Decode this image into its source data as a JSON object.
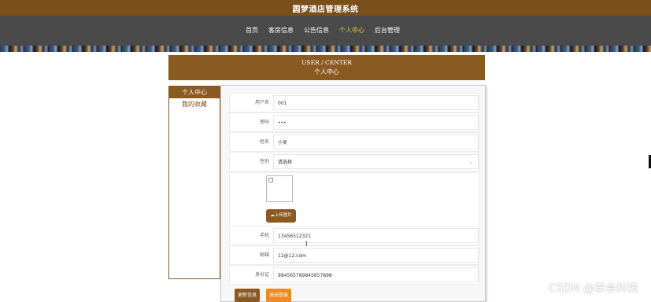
{
  "header": {
    "site_title": "圆梦酒店管理系统"
  },
  "nav": {
    "items": [
      {
        "label": "首页"
      },
      {
        "label": "客房信息"
      },
      {
        "label": "公告信息"
      },
      {
        "label": "个人中心",
        "active": true
      },
      {
        "label": "后台管理"
      }
    ]
  },
  "center": {
    "title_en": "USER / CENTER",
    "title_cn": "个人中心"
  },
  "sidebar": {
    "items": [
      {
        "label": "个人中心",
        "active": true
      },
      {
        "label": "我的收藏"
      }
    ]
  },
  "form": {
    "fields": [
      {
        "label": "用户名",
        "value": "001"
      },
      {
        "label": "密码",
        "value": "•••"
      },
      {
        "label": "姓名",
        "value": "小吴"
      },
      {
        "label": "性别",
        "value": "请选择"
      },
      {
        "label": "手机",
        "value": "13456512321"
      },
      {
        "label": "邮箱",
        "value": "12@12.com"
      },
      {
        "label": "身份证",
        "value": "984565789845657898"
      }
    ],
    "upload_label": "上传图片",
    "update_label": "更新信息",
    "logout_label": "退出登录"
  },
  "watermark": "CSDN @李会科技",
  "colors": {
    "primary": "#8a5a22",
    "nav_active": "#f5c54a",
    "logout": "#f08a24"
  }
}
